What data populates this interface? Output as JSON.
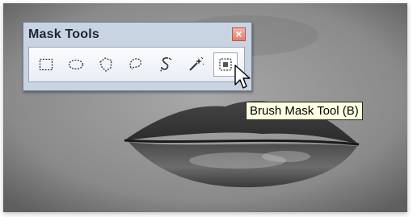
{
  "panel": {
    "title": "Mask Tools",
    "close_glyph": "×"
  },
  "tools": [
    {
      "name": "rectangle-mask-tool",
      "icon": "dashed-rectangle-icon"
    },
    {
      "name": "ellipse-mask-tool",
      "icon": "dashed-ellipse-icon"
    },
    {
      "name": "polygon-mask-tool",
      "icon": "dashed-polygon-icon"
    },
    {
      "name": "freehand-mask-tool",
      "icon": "dashed-lasso-icon"
    },
    {
      "name": "smart-edge-mask-tool",
      "icon": "smart-edge-lasso-icon"
    },
    {
      "name": "magic-wand-tool",
      "icon": "magic-wand-icon"
    },
    {
      "name": "brush-mask-tool",
      "icon": "brush-mask-icon",
      "active": true
    }
  ],
  "tooltip": {
    "text": "Brush Mask Tool (B)"
  },
  "colors": {
    "palette_bg": "#c9d4e3",
    "close_red": "#e0806c",
    "tooltip_bg": "#ffffe1"
  }
}
